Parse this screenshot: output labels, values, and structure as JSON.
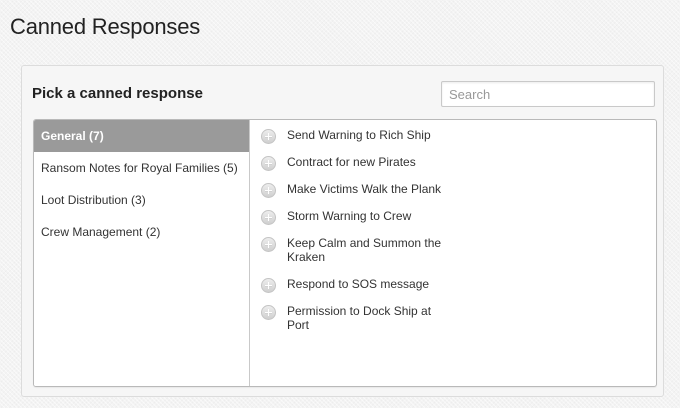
{
  "page": {
    "title": "Canned Responses"
  },
  "panel": {
    "title": "Pick a canned response",
    "search": {
      "placeholder": "Search",
      "value": ""
    }
  },
  "categories": [
    {
      "label": "General (7)",
      "active": true
    },
    {
      "label": "Ransom Notes for Royal Families (5)",
      "active": false
    },
    {
      "label": "Loot Distribution (3)",
      "active": false
    },
    {
      "label": "Crew Management (2)",
      "active": false
    }
  ],
  "responses": [
    {
      "label": "Send Warning to Rich Ship",
      "icon": "plus-circle-icon"
    },
    {
      "label": "Contract for new Pirates",
      "icon": "plus-circle-icon"
    },
    {
      "label": "Make Victims Walk the Plank",
      "icon": "plus-circle-icon"
    },
    {
      "label": "Storm Warning to Crew",
      "icon": "plus-circle-icon"
    },
    {
      "label": "Keep Calm and Summon the Kraken",
      "icon": "plus-circle-icon"
    },
    {
      "label": "Respond to SOS message",
      "icon": "plus-circle-icon"
    },
    {
      "label": "Permission to Dock Ship at Port",
      "icon": "plus-circle-icon"
    }
  ],
  "colors": {
    "active_category_bg": "#9a9a9a",
    "active_category_text": "#ffffff"
  }
}
